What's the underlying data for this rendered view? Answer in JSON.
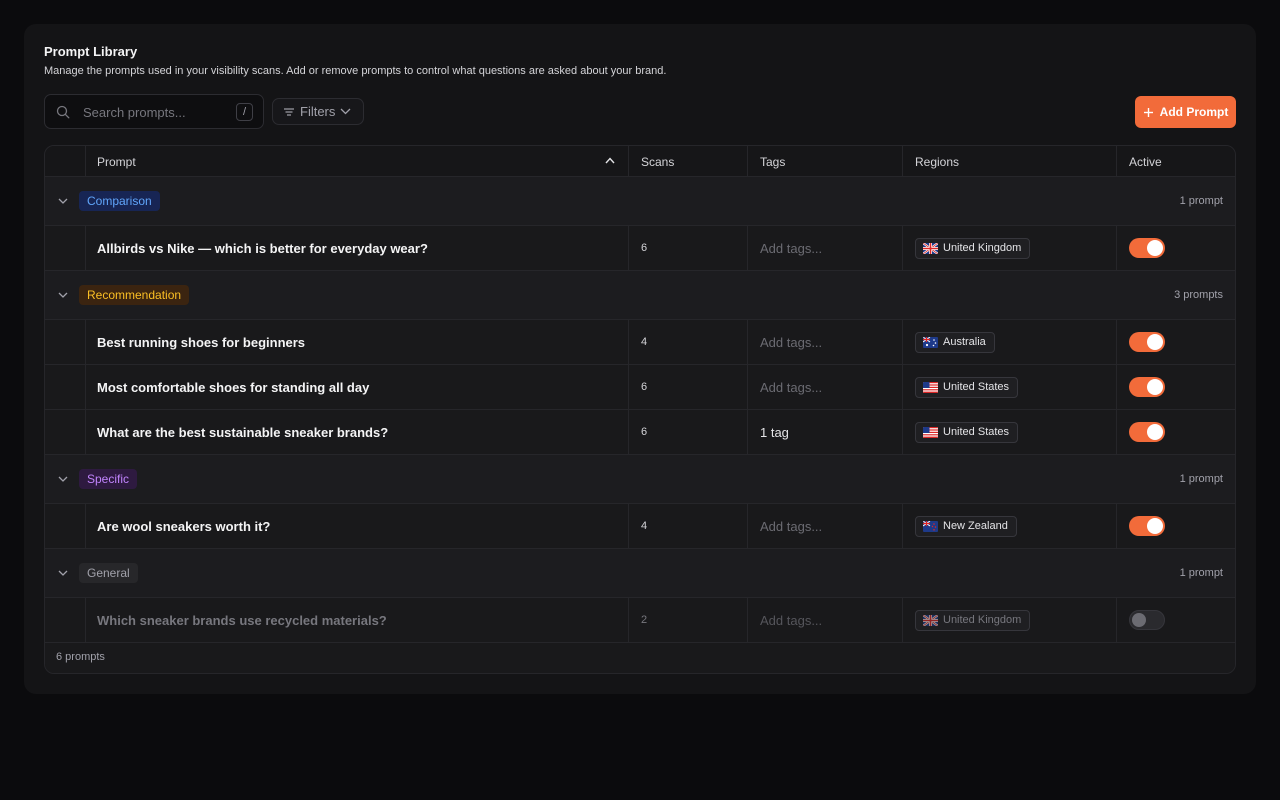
{
  "header": {
    "title": "Prompt Library",
    "subtitle": "Manage the prompts used in your visibility scans. Add or remove prompts to control what questions are asked about your brand."
  },
  "toolbar": {
    "search_placeholder": "Search prompts...",
    "search_shortcut": "/",
    "filters_label": "Filters",
    "add_label": "Add Prompt"
  },
  "table": {
    "columns": {
      "prompt": "Prompt",
      "scans": "Scans",
      "tags": "Tags",
      "regions": "Regions",
      "active": "Active"
    },
    "groups": [
      {
        "name": "Comparison",
        "count": "1 prompt",
        "badge_bg": "#172554",
        "badge_color": "#60a5fa",
        "rows": [
          {
            "prompt": "Allbirds vs Nike — which is better for everyday wear?",
            "scans": "6",
            "tags": "Add tags...",
            "region": "United Kingdom",
            "flag": "uk",
            "active": true
          }
        ]
      },
      {
        "name": "Recommendation",
        "count": "3 prompts",
        "badge_bg": "#3b2410",
        "badge_color": "#fbbf24",
        "rows": [
          {
            "prompt": "Best running shoes for beginners",
            "scans": "4",
            "tags": "Add tags...",
            "region": "Australia",
            "flag": "au",
            "active": true
          },
          {
            "prompt": "Most comfortable shoes for standing all day",
            "scans": "6",
            "tags": "Add tags...",
            "region": "United States",
            "flag": "us",
            "active": true
          },
          {
            "prompt": "What are the best sustainable sneaker brands?",
            "scans": "6",
            "tags": "1 tag",
            "region": "United States",
            "flag": "us",
            "active": true
          }
        ]
      },
      {
        "name": "Specific",
        "count": "1 prompt",
        "badge_bg": "#2e1a40",
        "badge_color": "#c084fc",
        "rows": [
          {
            "prompt": "Are wool sneakers worth it?",
            "scans": "4",
            "tags": "Add tags...",
            "region": "New Zealand",
            "flag": "nz",
            "active": true
          }
        ]
      },
      {
        "name": "General",
        "count": "1 prompt",
        "badge_bg": "#27272a",
        "badge_color": "#a1a1aa",
        "rows": [
          {
            "prompt": "Which sneaker brands use recycled materials?",
            "scans": "2",
            "tags": "Add tags...",
            "region": "United Kingdom",
            "flag": "uk",
            "active": false
          }
        ]
      }
    ],
    "footer": "6 prompts"
  },
  "colors": {
    "accent": "#f26b3a",
    "background": "#0b0b0d",
    "card": "#141416"
  },
  "icons": {
    "search": "search-icon",
    "filter": "filter-icon",
    "plus": "plus-icon",
    "sort": "chevron-up-icon",
    "collapse": "chevron-down-icon"
  }
}
